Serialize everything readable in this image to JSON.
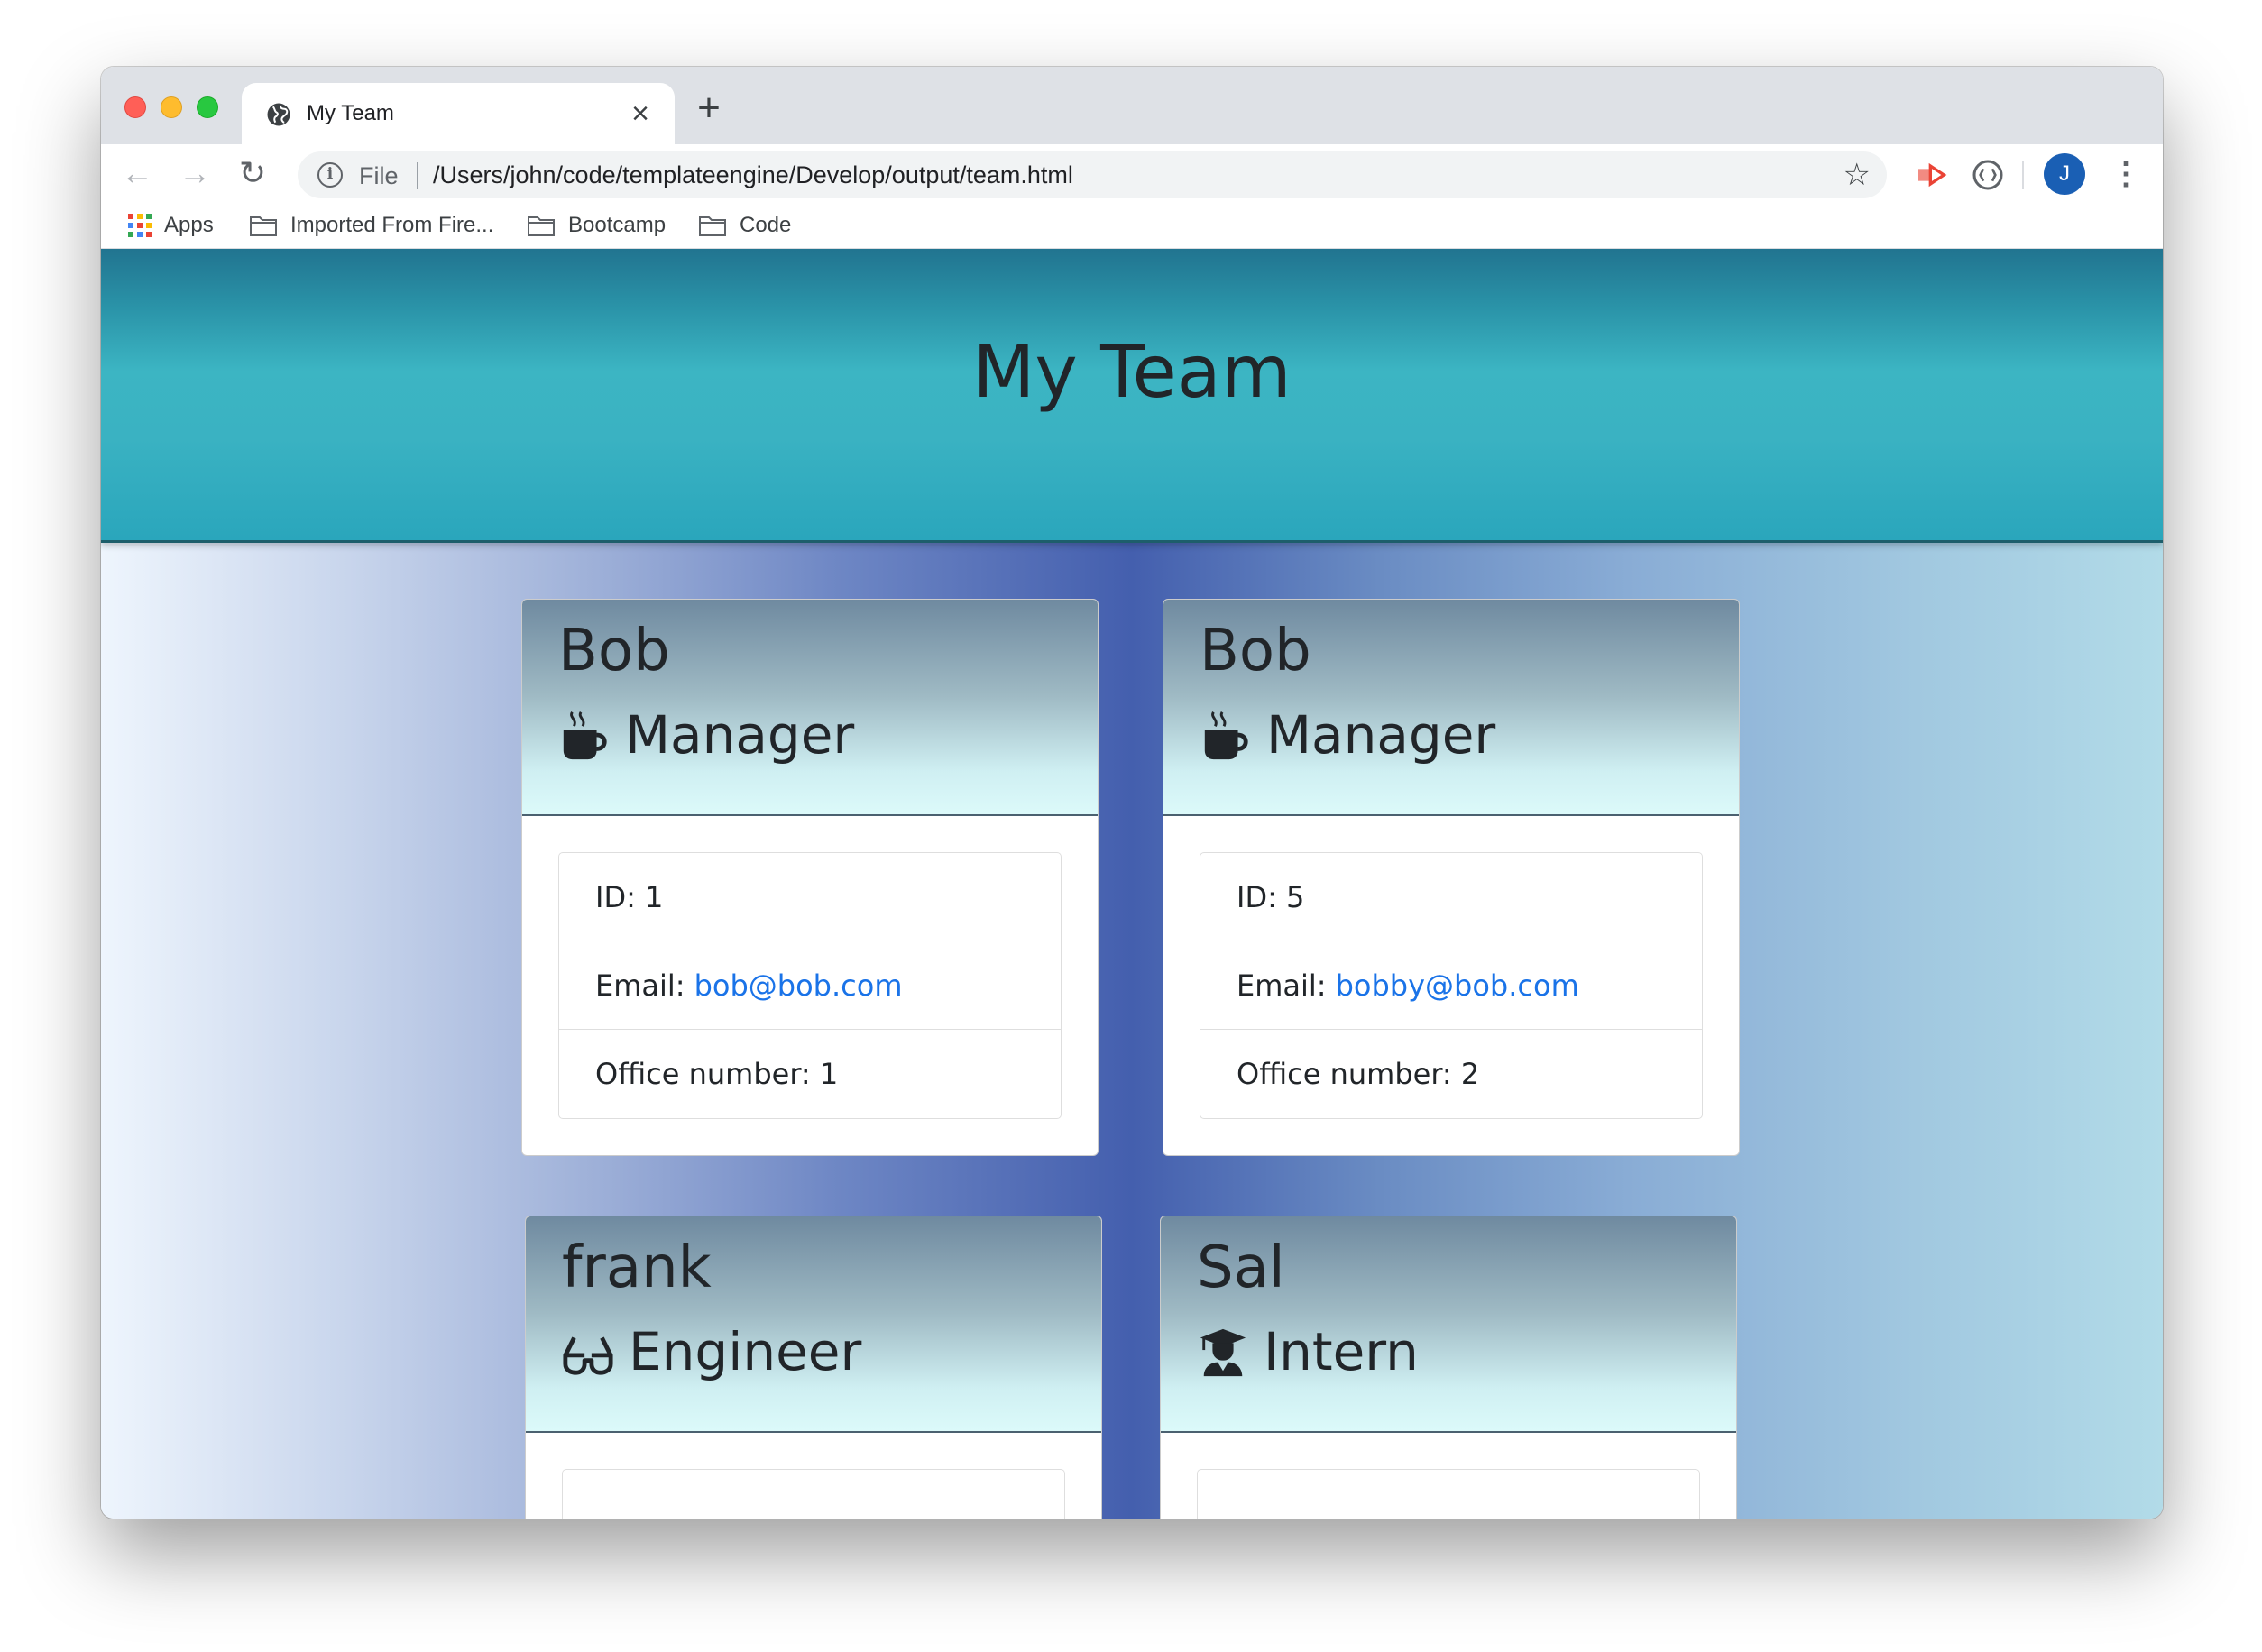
{
  "browser": {
    "tab_title": "My Team",
    "tab_close": "×",
    "new_tab": "+",
    "url_scheme": "File",
    "url": "/Users/john/code/templateengine/Develop/output/team.html",
    "profile_initial": "J",
    "nav": {
      "back": "←",
      "forward": "→",
      "reload": "↻",
      "star": "☆",
      "menu": "⋮"
    },
    "bookmarks": [
      {
        "label": "Apps",
        "icon": "apps-grid-icon"
      },
      {
        "label": "Imported From Fire...",
        "icon": "folder-icon"
      },
      {
        "label": "Bootcamp",
        "icon": "folder-icon"
      },
      {
        "label": "Code",
        "icon": "folder-icon"
      }
    ]
  },
  "page": {
    "title": "My Team",
    "cards": [
      {
        "name": "Bob",
        "role": "Manager",
        "icon": "mug-icon",
        "id_label": "ID: 1",
        "email_label": "Email:",
        "email": "bob@bob.com",
        "extra": "Office number: 1"
      },
      {
        "name": "Bob",
        "role": "Manager",
        "icon": "mug-icon",
        "id_label": "ID: 5",
        "email_label": "Email:",
        "email": "bobby@bob.com",
        "extra": "Office number: 2"
      },
      {
        "name": "frank",
        "role": "Engineer",
        "icon": "glasses-icon"
      },
      {
        "name": "Sal",
        "role": "Intern",
        "icon": "graduate-icon"
      }
    ]
  },
  "colors": {
    "header_dark": "#217490",
    "header_light": "#3cb5c3",
    "link": "#1a73e8",
    "page_center": "#445fae"
  }
}
